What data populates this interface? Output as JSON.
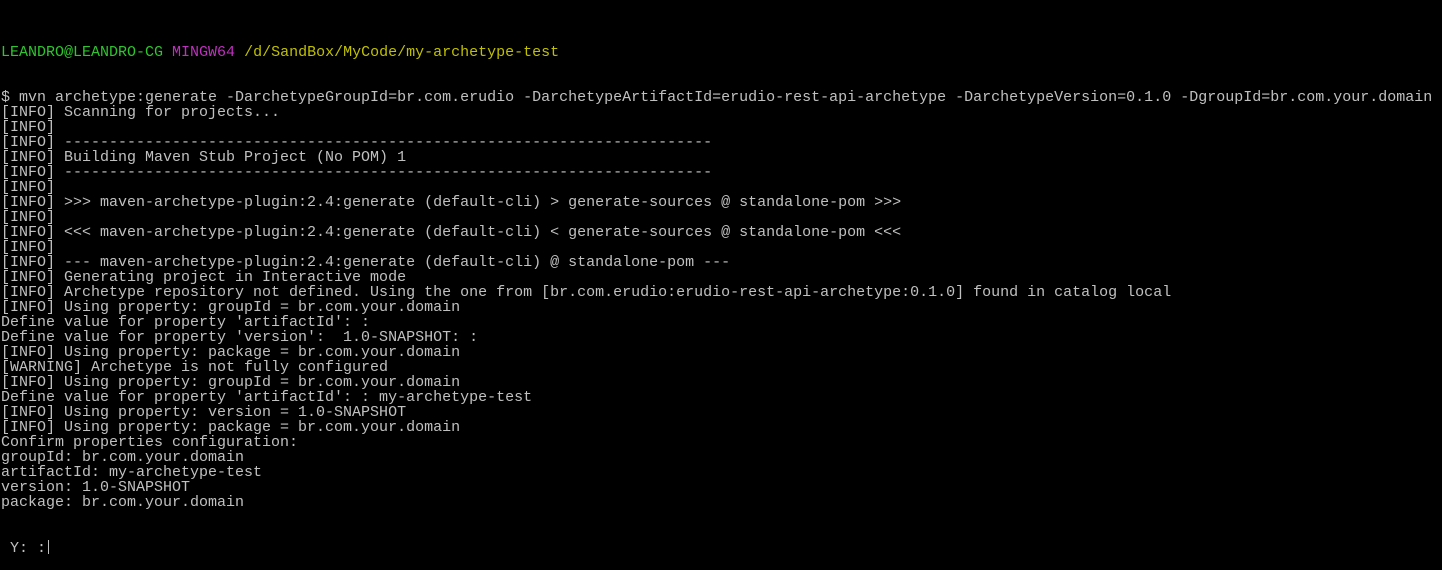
{
  "prompt": {
    "user_host": "LEANDRO@LEANDRO-CG",
    "system": "MINGW64",
    "cwd": "/d/SandBox/MyCode/my-archetype-test"
  },
  "colors": {
    "background": "#000000",
    "text": "#c0c0c0",
    "user_host": "#2ec52e",
    "system": "#c030c0",
    "cwd": "#c0c000"
  },
  "output_lines": [
    "$ mvn archetype:generate -DarchetypeGroupId=br.com.erudio -DarchetypeArtifactId=erudio-rest-api-archetype -DarchetypeVersion=0.1.0 -DgroupId=br.com.your.domain",
    "[INFO] Scanning for projects...",
    "[INFO]",
    "[INFO] ------------------------------------------------------------------------",
    "[INFO] Building Maven Stub Project (No POM) 1",
    "[INFO] ------------------------------------------------------------------------",
    "[INFO]",
    "[INFO] >>> maven-archetype-plugin:2.4:generate (default-cli) > generate-sources @ standalone-pom >>>",
    "[INFO]",
    "[INFO] <<< maven-archetype-plugin:2.4:generate (default-cli) < generate-sources @ standalone-pom <<<",
    "[INFO]",
    "[INFO] --- maven-archetype-plugin:2.4:generate (default-cli) @ standalone-pom ---",
    "[INFO] Generating project in Interactive mode",
    "[INFO] Archetype repository not defined. Using the one from [br.com.erudio:erudio-rest-api-archetype:0.1.0] found in catalog local",
    "[INFO] Using property: groupId = br.com.your.domain",
    "Define value for property 'artifactId': :",
    "Define value for property 'version':  1.0-SNAPSHOT: :",
    "[INFO] Using property: package = br.com.your.domain",
    "[WARNING] Archetype is not fully configured",
    "[INFO] Using property: groupId = br.com.your.domain",
    "Define value for property 'artifactId': : my-archetype-test",
    "[INFO] Using property: version = 1.0-SNAPSHOT",
    "[INFO] Using property: package = br.com.your.domain",
    "Confirm properties configuration:",
    "groupId: br.com.your.domain",
    "artifactId: my-archetype-test",
    "version: 1.0-SNAPSHOT",
    "package: br.com.your.domain"
  ],
  "input_prompt": " Y: :"
}
